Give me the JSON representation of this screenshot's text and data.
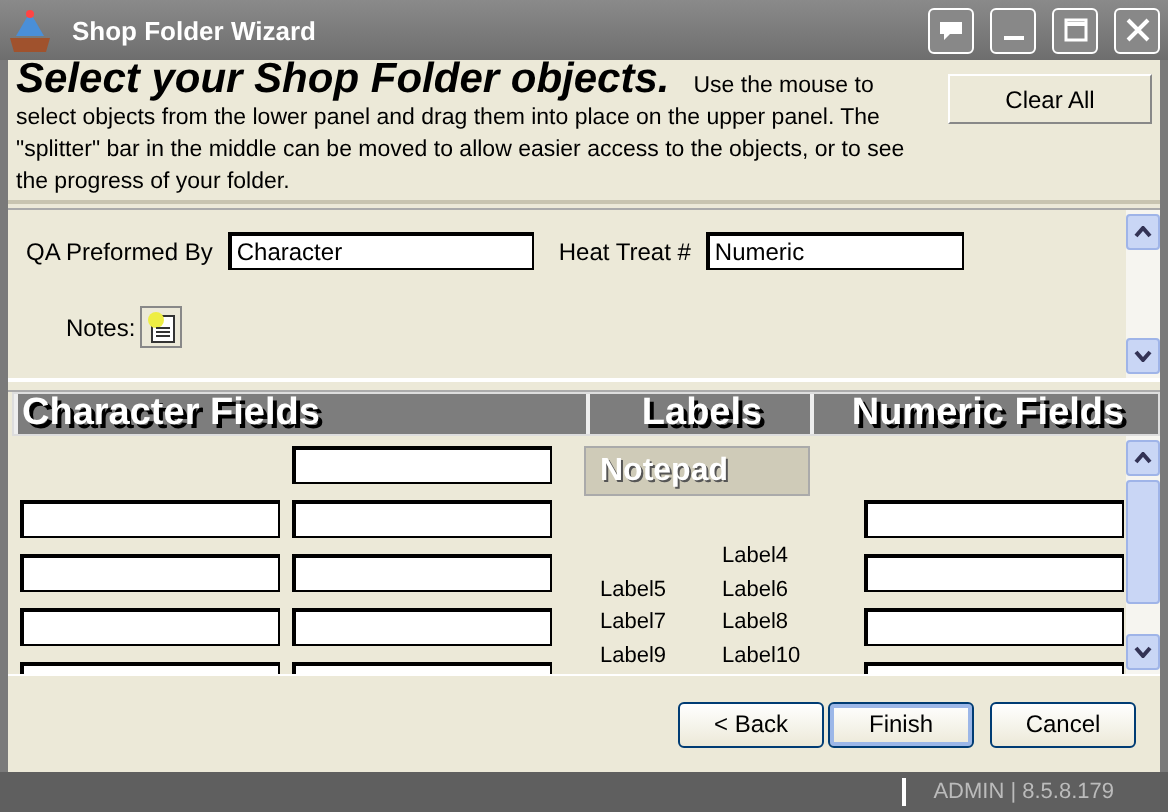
{
  "window": {
    "title": "Shop Folder Wizard"
  },
  "header": {
    "title": "Select your Shop Folder objects.",
    "description": "Use the mouse to select objects from the lower panel and drag them into place on the upper panel.  The \"splitter\" bar in the middle can be moved to allow easier access to the objects, or to see the progress of your folder.",
    "clear_button": "Clear All"
  },
  "upper_panel": {
    "fields": [
      {
        "label": "QA Preformed By",
        "value": "Character"
      },
      {
        "label": "Heat Treat #",
        "value": "Numeric"
      }
    ],
    "notes_label": "Notes:"
  },
  "lower_panel": {
    "columns": [
      "Character Fields",
      "Labels",
      "Numeric Fields"
    ],
    "notepad": "Notepad",
    "rows": [
      {
        "character_2": true
      },
      {
        "character_1": true,
        "character_2": true,
        "numeric": true
      },
      {
        "character_1": true,
        "character_2": true,
        "numeric": true
      },
      {
        "character_1": true,
        "character_2": true,
        "numeric": true
      },
      {
        "character_1": true,
        "character_2": true,
        "numeric": true
      }
    ],
    "labels": [
      {
        "right": "Label4"
      },
      {
        "left": "Label5",
        "right": "Label6"
      },
      {
        "left": "Label7",
        "right": "Label8"
      },
      {
        "left": "Label9",
        "right": "Label10"
      }
    ]
  },
  "buttons": [
    {
      "label": "< Back",
      "selected": false
    },
    {
      "label": "Finish",
      "selected": true
    },
    {
      "label": "Cancel",
      "selected": false
    }
  ],
  "status_bar": {
    "text": "ADMIN | 8.5.8.179"
  }
}
